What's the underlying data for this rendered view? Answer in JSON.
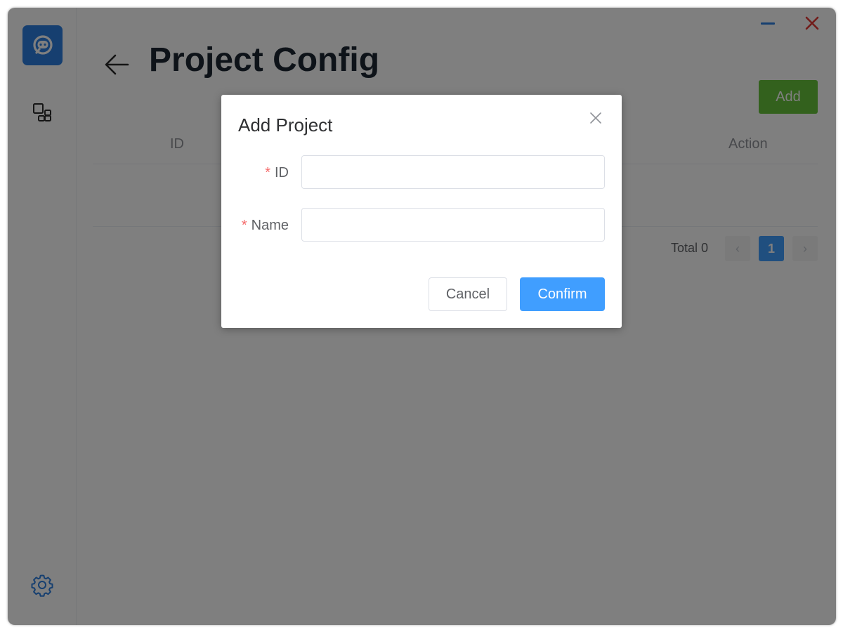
{
  "header": {
    "title": "Project Config",
    "add_label": "Add"
  },
  "table": {
    "columns": [
      "ID",
      "Action"
    ]
  },
  "pagination": {
    "total_label": "Total 0",
    "current_page": "1",
    "prev_glyph": "‹",
    "next_glyph": "›"
  },
  "dialog": {
    "title": "Add Project",
    "fields": [
      {
        "label": "ID",
        "required_mark": "*",
        "value": "",
        "placeholder": ""
      },
      {
        "label": "Name",
        "required_mark": "*",
        "value": "",
        "placeholder": ""
      }
    ],
    "cancel_label": "Cancel",
    "confirm_label": "Confirm"
  },
  "icons": {
    "logo": "chat-bubble-logo-icon",
    "nav": "grid-dashboard-icon",
    "settings": "gear-icon",
    "back": "arrow-left-icon",
    "minimize": "minimize-icon",
    "close": "close-icon",
    "dialog_close": "close-icon"
  },
  "colors": {
    "brand": "#2d7fe0",
    "primary": "#409eff",
    "success": "#67c23a",
    "danger": "#f56c6c",
    "overlay": "rgba(0,0,0,0.5)"
  }
}
